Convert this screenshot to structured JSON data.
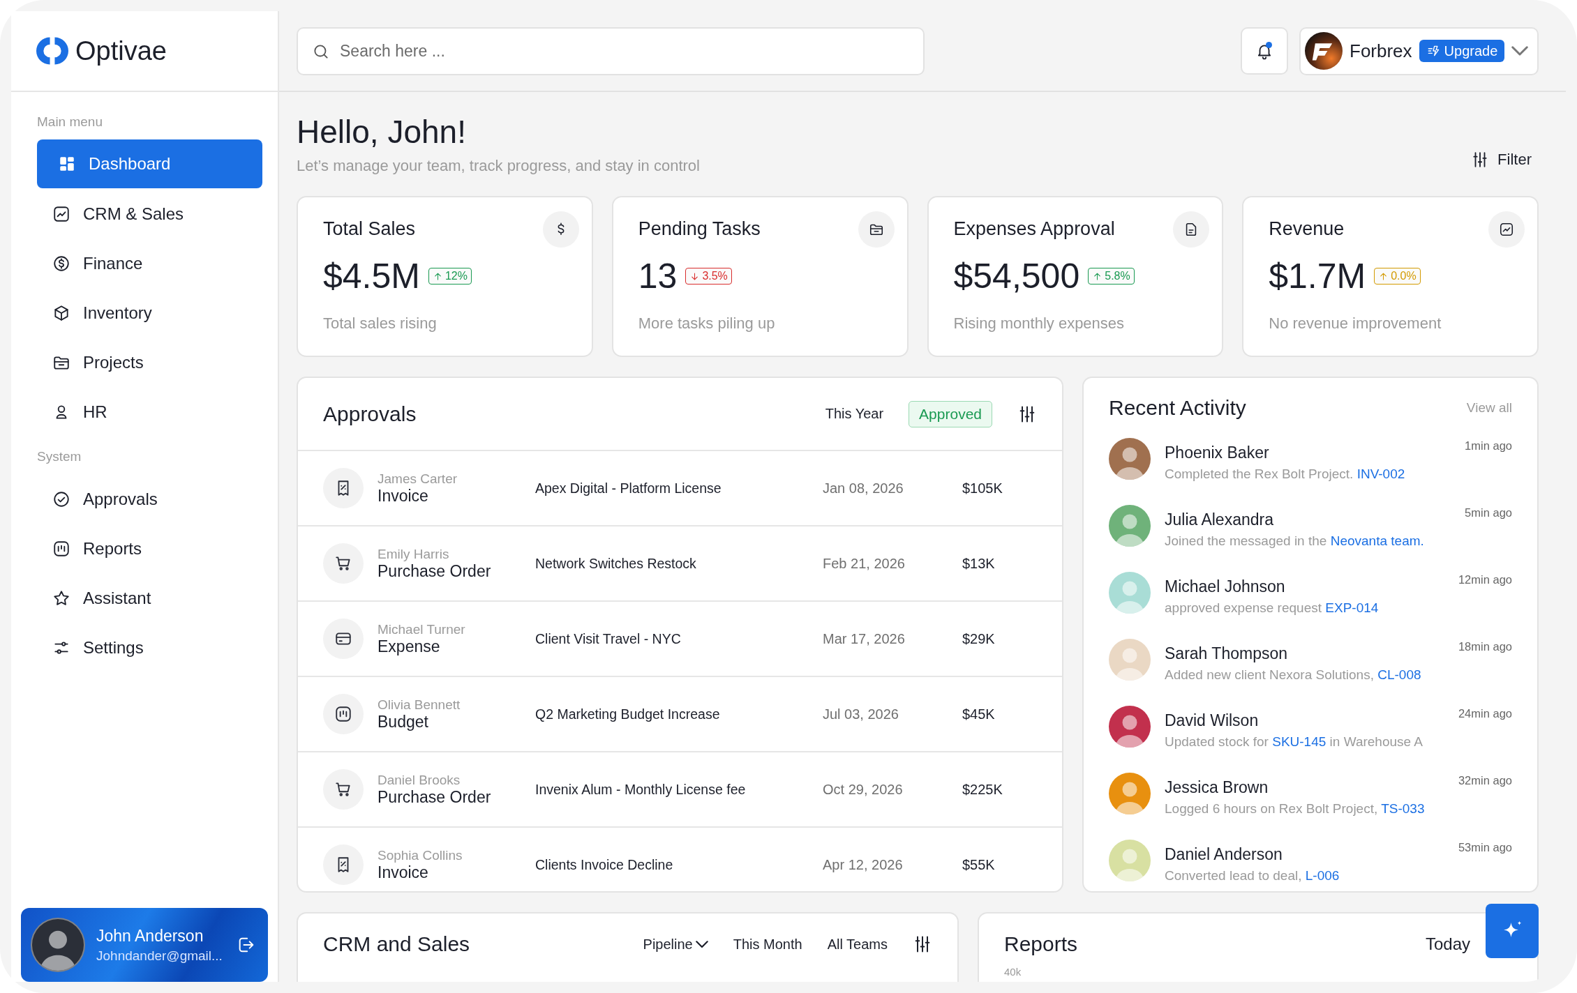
{
  "brand": {
    "name": "Optivae"
  },
  "sidebar": {
    "sections": [
      {
        "label": "Main menu",
        "items": [
          {
            "label": "Dashboard",
            "kind": "grid",
            "selected": true
          },
          {
            "label": "CRM & Sales",
            "kind": "chart",
            "selected": false
          },
          {
            "label": "Finance",
            "kind": "dollar",
            "selected": false
          },
          {
            "label": "Inventory",
            "kind": "box",
            "selected": false
          },
          {
            "label": "Projects",
            "kind": "folder",
            "selected": false
          },
          {
            "label": "HR",
            "kind": "person",
            "selected": false
          }
        ]
      },
      {
        "label": "System",
        "items": [
          {
            "label": "Approvals",
            "kind": "check",
            "selected": false
          },
          {
            "label": "Reports",
            "kind": "bars",
            "selected": false
          },
          {
            "label": "Assistant",
            "kind": "star",
            "selected": false
          },
          {
            "label": "Settings",
            "kind": "sliders",
            "selected": false
          }
        ]
      }
    ],
    "user": {
      "name": "John Anderson",
      "email": "Johndander@gmail..."
    }
  },
  "search": {
    "placeholder": "Search here ..."
  },
  "notifications": {
    "unread": true
  },
  "account": {
    "name": "Forbrex",
    "upgrade": "Upgrade"
  },
  "greeting": {
    "title": "Hello, John!",
    "subtitle": "Let’s manage your team, track progress, and stay in control"
  },
  "filter": "Filter",
  "stats": [
    {
      "title": "Total Sales",
      "kind": "dollar-sign",
      "value": "$4.5M",
      "change": {
        "text": "12%",
        "kind": "up",
        "color": "#1a9a52"
      },
      "caption": "Total sales rising"
    },
    {
      "title": "Pending Tasks",
      "kind": "folder",
      "value": "13",
      "change": {
        "text": "3.5%",
        "kind": "down",
        "color": "#d92d2d"
      },
      "caption": "More tasks piling up"
    },
    {
      "title": "Expenses Approval",
      "kind": "document",
      "value": "$54,500",
      "change": {
        "text": "5.8%",
        "kind": "up",
        "color": "#1a9a52"
      },
      "caption": "Rising monthly expenses"
    },
    {
      "title": "Revenue",
      "kind": "chart",
      "value": "$1.7M",
      "change": {
        "text": "0.0%",
        "kind": "up",
        "color": "#d39a00"
      },
      "caption": "No revenue improvement"
    }
  ],
  "approvals": {
    "title": "Approvals",
    "period": "This Year",
    "status": "Approved",
    "rows": [
      {
        "kind": "receipt",
        "person": "James Carter",
        "type": "Invoice",
        "description": "Apex Digital - Platform License",
        "date": "Jan 08, 2026",
        "amount": "$105K"
      },
      {
        "kind": "cart",
        "person": "Emily Harris",
        "type": "Purchase Order",
        "description": "Network Switches Restock",
        "date": "Feb 21, 2026",
        "amount": "$13K"
      },
      {
        "kind": "card",
        "person": "Michael Turner",
        "type": "Expense",
        "description": "Client Visit Travel - NYC",
        "date": "Mar 17, 2026",
        "amount": "$29K"
      },
      {
        "kind": "bars",
        "person": "Olivia Bennett",
        "type": "Budget",
        "description": "Q2 Marketing Budget Increase",
        "date": "Jul 03, 2026",
        "amount": "$45K"
      },
      {
        "kind": "cart",
        "person": "Daniel Brooks",
        "type": "Purchase Order",
        "description": "Invenix Alum - Monthly License fee",
        "date": "Oct 29, 2026",
        "amount": "$225K"
      },
      {
        "kind": "receipt",
        "person": "Sophia Collins",
        "type": "Invoice",
        "description": "Clients Invoice Decline",
        "date": "Apr 12, 2026",
        "amount": "$55K"
      }
    ]
  },
  "activity": {
    "title": "Recent Activity",
    "view_all": "View all",
    "items": [
      {
        "name": "Phoenix Baker",
        "color": "#a0704f",
        "before": "Completed the Rex Bolt Project. ",
        "ref": "INV-002",
        "time": "1min ago"
      },
      {
        "name": "Julia Alexandra",
        "color": "#6fb27a",
        "before": "Joined the messaged in the ",
        "ref": "Neovanta team.",
        "time": "5min ago"
      },
      {
        "name": "Michael Johnson",
        "color": "#a9ddd6",
        "before": "approved expense request ",
        "ref": "EXP-014",
        "time": "12min ago"
      },
      {
        "name": "Sarah Thompson",
        "color": "#ead8c4",
        "before": "Added new client Nexora Solutions, ",
        "ref": "CL-008",
        "time": "18min ago"
      },
      {
        "name": "David Wilson",
        "color": "#c2304d",
        "before": "Updated stock for ",
        "ref": "SKU-145",
        "after": " in Warehouse A",
        "time": "24min ago"
      },
      {
        "name": "Jessica Brown",
        "color": "#e8900f",
        "before": "Logged 6 hours on Rex Bolt Project, ",
        "ref": "TS-033",
        "time": "32min ago"
      },
      {
        "name": "Daniel Anderson",
        "color": "#d8e0a2",
        "before": "Converted lead to deal, ",
        "ref": "L-006",
        "time": "53min ago"
      }
    ]
  },
  "crm": {
    "title": "CRM and Sales",
    "filters": [
      {
        "label": "Pipeline",
        "dropdown": true
      },
      {
        "label": "This Month",
        "dropdown": false
      },
      {
        "label": "All Teams",
        "dropdown": false
      }
    ]
  },
  "reports": {
    "title": "Reports",
    "period": "Today",
    "axis_label": "40k"
  }
}
